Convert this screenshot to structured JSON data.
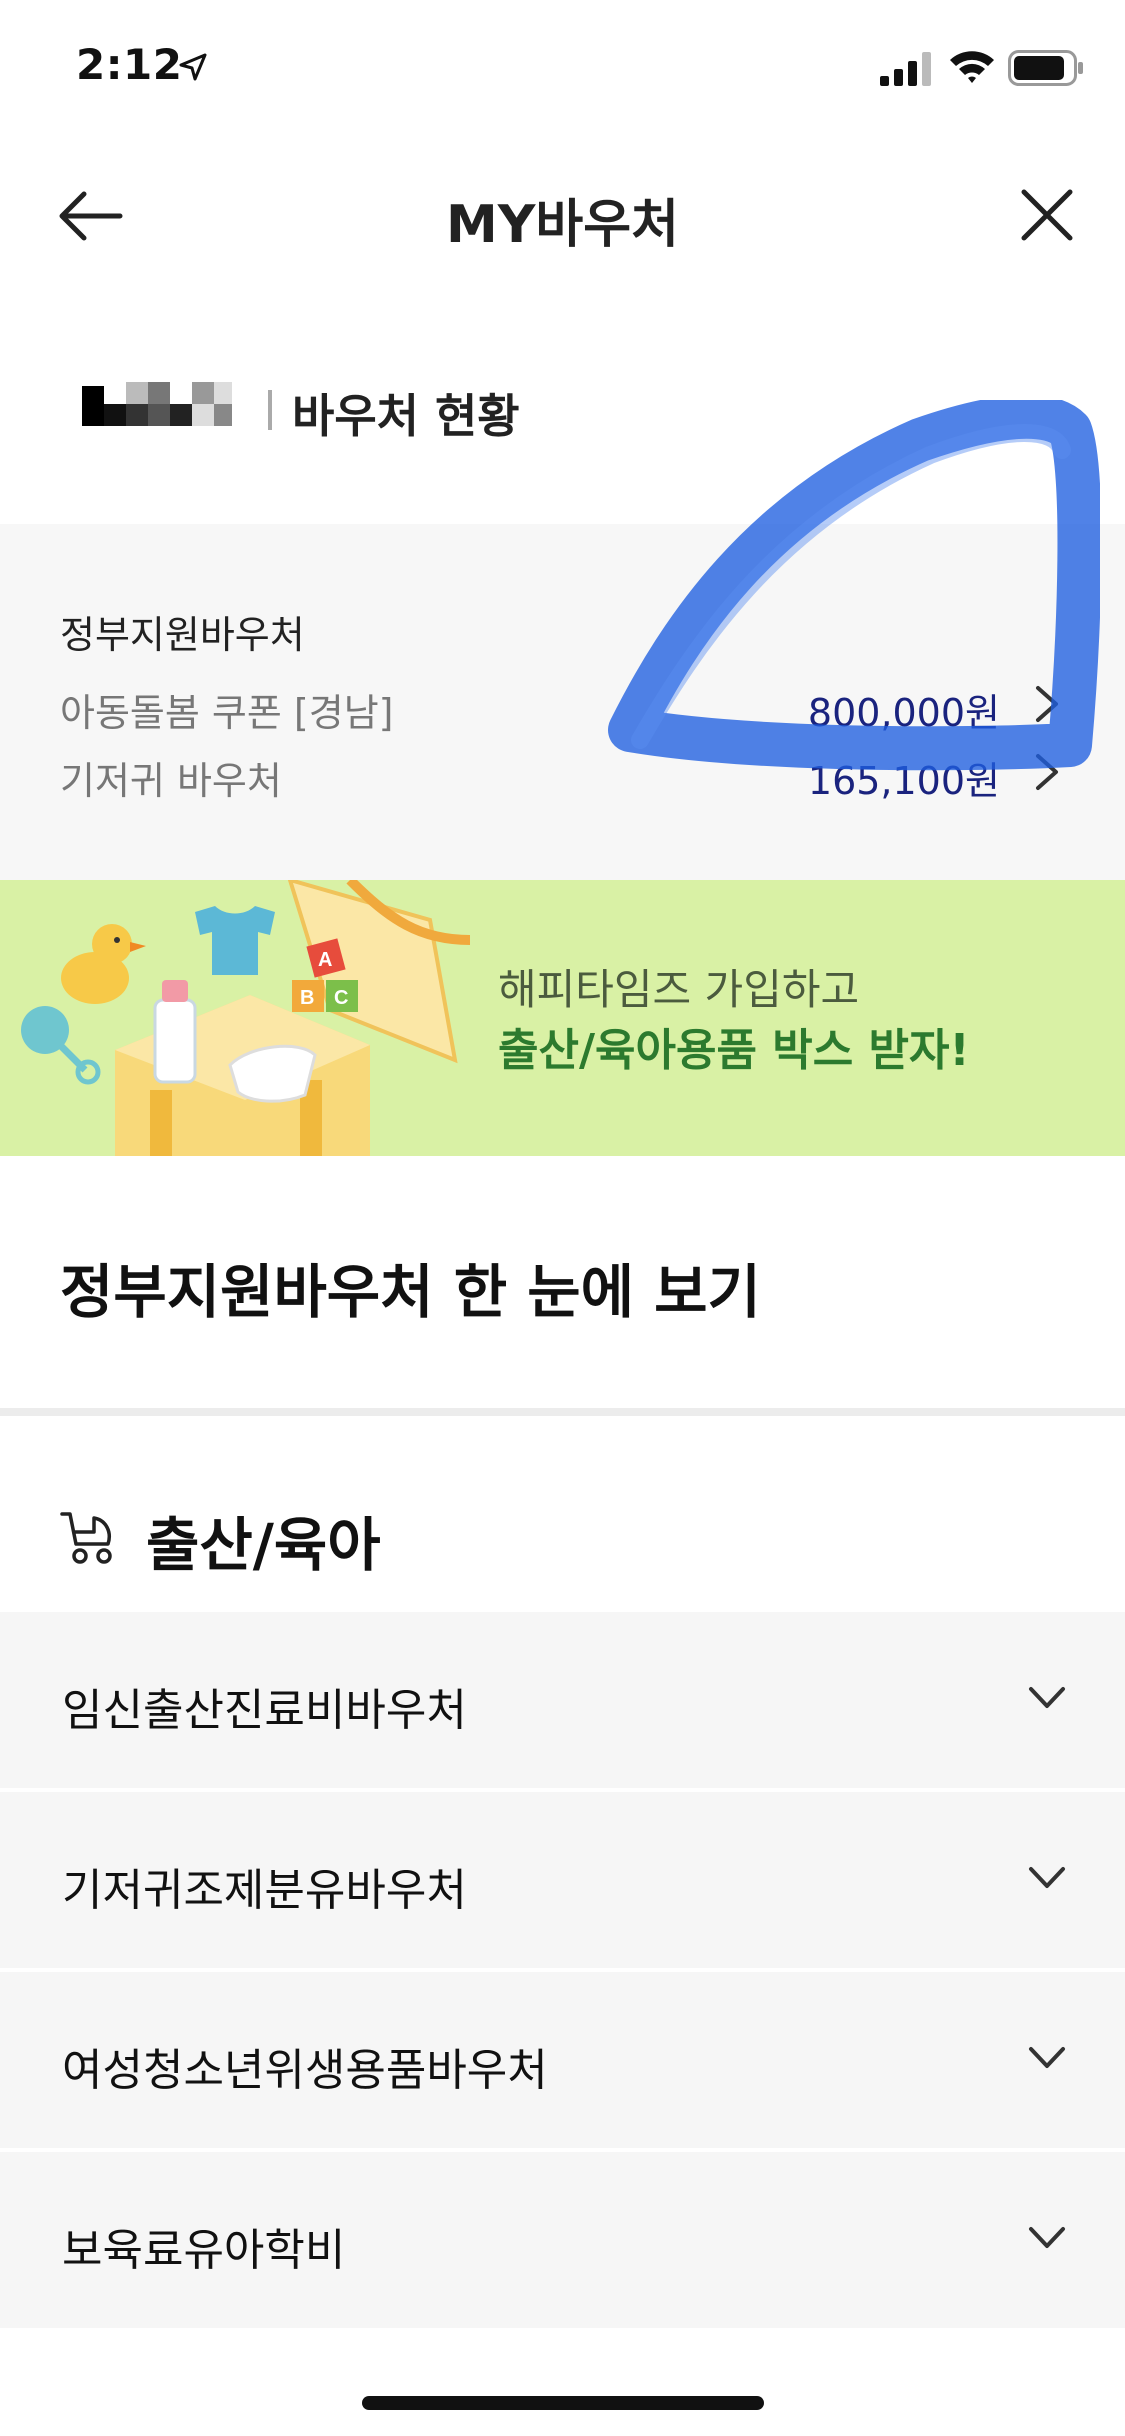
{
  "status_bar": {
    "time": "2:12"
  },
  "header": {
    "title": "MY바우처"
  },
  "voucher_status": {
    "title": "바우처 현황",
    "section_title": "정부지원바우처",
    "items": [
      {
        "name": "아동돌봄 쿠폰 [경남]",
        "amount": "800,000원"
      },
      {
        "name": "기저귀 바우처",
        "amount": "165,100원"
      }
    ]
  },
  "banner": {
    "line1": "해피타임즈 가입하고",
    "line2": "출산/육아용품 박스 받자!",
    "block_letters": [
      "A",
      "B",
      "C"
    ]
  },
  "overview": {
    "title": "정부지원바우처 한 눈에 보기"
  },
  "category": {
    "title": "출산/육아",
    "items": [
      {
        "label": "임신출산진료비바우처"
      },
      {
        "label": "기저귀조제분유바우처"
      },
      {
        "label": "여성청소년위생용품바우처"
      },
      {
        "label": "보육료유아학비"
      }
    ]
  },
  "colors": {
    "banner_bg": "#d9f1a5",
    "banner_highlight": "#2c7a2e",
    "amount": "#1a237e",
    "scribble": "#1f5fe0"
  }
}
